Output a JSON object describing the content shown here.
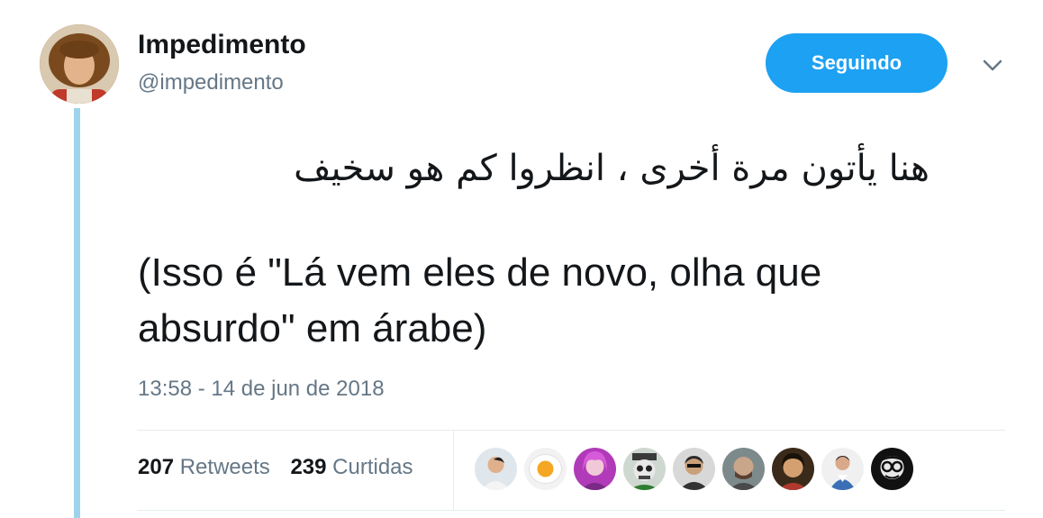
{
  "author": {
    "name": "Impedimento",
    "handle": "@impedimento",
    "avatar_icon": "user-avatar-icon"
  },
  "actions": {
    "follow_label": "Seguindo",
    "more_icon": "chevron-down-icon"
  },
  "tweet": {
    "arabic_text": "هنا يأتون مرة أخرى ، انظروا كم هو سخيف",
    "translation_line1": "(Isso é \"Lá vem eles de novo, olha que",
    "translation_line2": "absurdo\" em árabe)",
    "timestamp": "13:58 - 14 de jun de 2018"
  },
  "stats": {
    "retweets_count": "207",
    "retweets_label": "Retweets",
    "likes_count": "239",
    "likes_label": "Curtidas"
  },
  "likers": [
    {
      "icon": "liker-avatar-1"
    },
    {
      "icon": "liker-avatar-2"
    },
    {
      "icon": "liker-avatar-3"
    },
    {
      "icon": "liker-avatar-4"
    },
    {
      "icon": "liker-avatar-5"
    },
    {
      "icon": "liker-avatar-6"
    },
    {
      "icon": "liker-avatar-7"
    },
    {
      "icon": "liker-avatar-8"
    },
    {
      "icon": "liker-avatar-9"
    }
  ],
  "colors": {
    "accent": "#1da1f2",
    "thread_line": "#9fd3ec",
    "secondary_text": "#657786"
  }
}
